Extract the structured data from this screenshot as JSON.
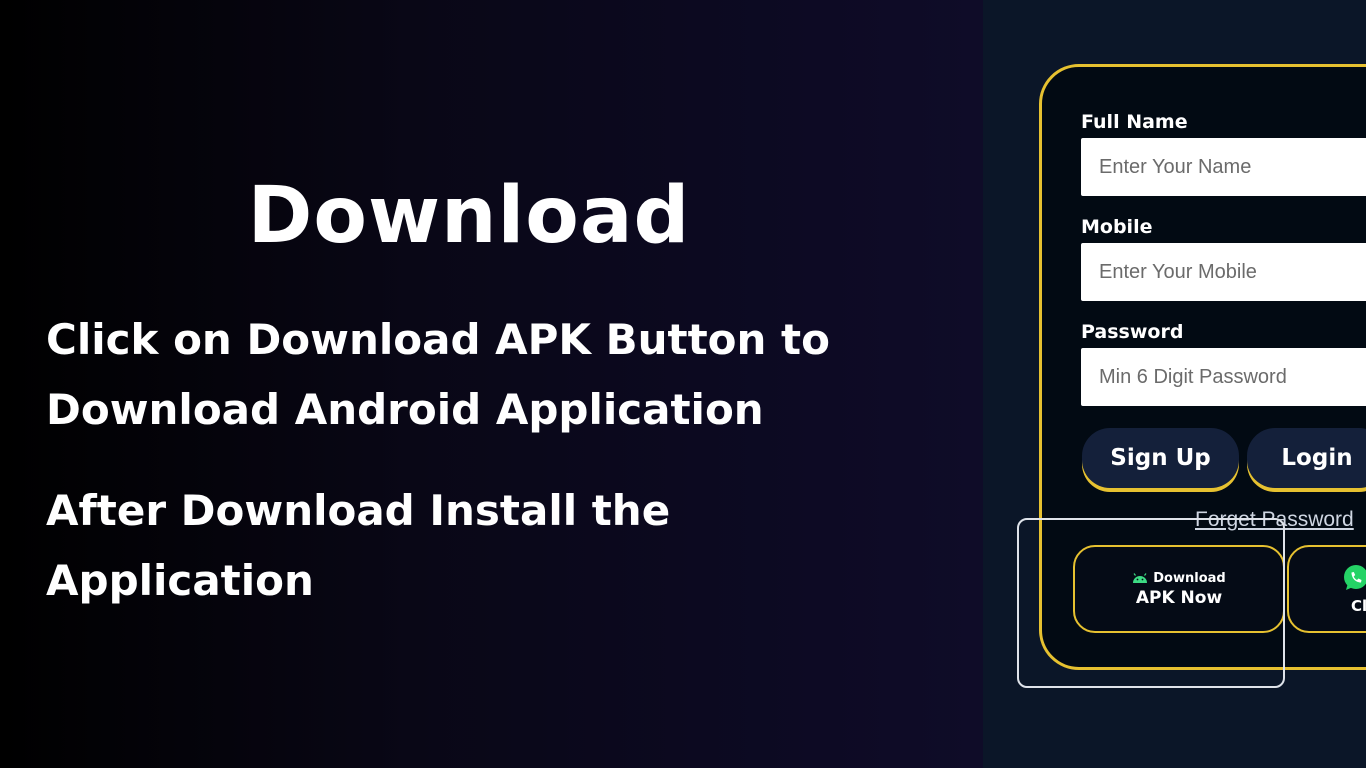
{
  "hero": {
    "title": "Download",
    "instruction_1": "Click on Download APK Button to Download Android Application",
    "instruction_2": "After Download Install the Application"
  },
  "form": {
    "full_name_label": "Full Name",
    "full_name_placeholder": "Enter Your Name",
    "mobile_label": "Mobile",
    "mobile_placeholder": "Enter Your Mobile",
    "password_label": "Password",
    "password_placeholder": "Min 6 Digit Password",
    "signup_label": "Sign Up",
    "login_label": "Login",
    "forget_password_label": "Forget Password"
  },
  "download_button": {
    "icon": "android-icon",
    "top_text": "Download",
    "bottom_text": "APK Now"
  },
  "chat_button": {
    "icon": "whatsapp-icon",
    "label": "Cl"
  },
  "colors": {
    "accent": "#e6c130",
    "button_bg": "#14203a",
    "panel_bg": "#0b1628",
    "android_green": "#3ddc84",
    "whatsapp_green": "#25d366"
  }
}
